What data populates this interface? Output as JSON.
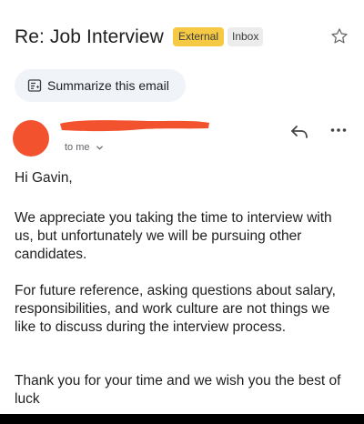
{
  "email": {
    "subject": "Re: Job Interview",
    "labels": {
      "external": "External",
      "inbox": "Inbox"
    },
    "summarize_label": "Summarize this email",
    "recipient": "to me",
    "greeting": "Hi Gavin,",
    "paragraphs": [
      "We appreciate you taking the time to interview with us, but unfortunately we will be pursuing other candidates.",
      "For future reference, asking questions about salary, responsibilities, and work culture are not things we like to discuss during the interview process.",
      "Thank you for your time and we wish you the best of luck"
    ]
  },
  "icons": {
    "star": "star-icon",
    "summarize": "summarize-icon",
    "reply": "reply-icon",
    "more": "more-horizontal-icon",
    "chevron": "chevron-down-icon"
  },
  "colors": {
    "external_label": "#f6c945",
    "inbox_label": "#ececec",
    "avatar": "#f2522e",
    "redaction": "#f2522e",
    "summarize_bg": "#f0f4f9"
  }
}
